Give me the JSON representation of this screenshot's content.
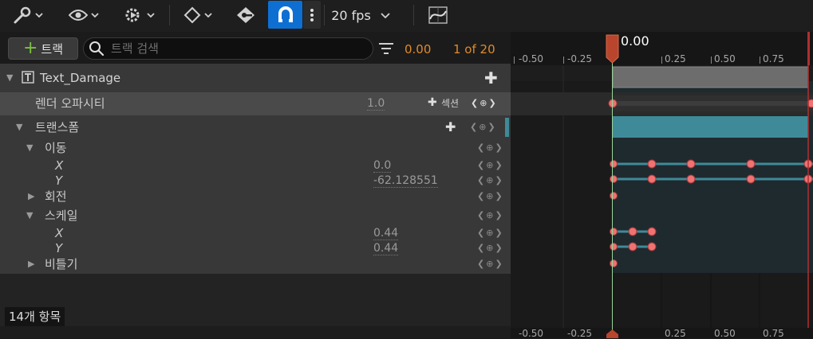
{
  "toolbar": {
    "fps_label": "20 fps",
    "icons": [
      "wrench-icon",
      "eye-icon",
      "gear-play-icon",
      "diamond-icon",
      "key-icon",
      "magnet-icon",
      "more-vertical-icon",
      "curve-editor-icon"
    ]
  },
  "search_row": {
    "add_track_label": "트랙",
    "search_placeholder": "트랙 검색",
    "current_time": "0.00",
    "frame_count": "1 of 20"
  },
  "tree": {
    "root": {
      "label": "Text_Damage"
    },
    "render_opacity": {
      "label": "렌더 오파시티",
      "value": "1.0",
      "section_label": "섹션"
    },
    "transform": {
      "label": "트랜스폼"
    },
    "translation": {
      "label": "이동",
      "x_label": "X",
      "x_value": "0.0",
      "y_label": "Y",
      "y_value": "-62.128551"
    },
    "rotation": {
      "label": "회전"
    },
    "scale": {
      "label": "스케일",
      "x_label": "X",
      "x_value": "0.44",
      "y_label": "Y",
      "y_value": "0.44"
    },
    "shear": {
      "label": "비틀기"
    }
  },
  "status": {
    "item_count": "14개 항목"
  },
  "timeline": {
    "playhead_time": "0.00",
    "ticks": [
      "-0.50",
      "-0.25",
      "0.25",
      "0.50",
      "0.75"
    ],
    "bottom_ticks": [
      "-0.50",
      "-0.25",
      "0.25",
      "0.50",
      "0.75"
    ]
  },
  "colors": {
    "accent_blue": "#0e6fd3",
    "orange_time": "#e08a2a",
    "transform_bar": "#3f8a99",
    "keyframe": "#f07272",
    "add_green": "#7bc043"
  }
}
